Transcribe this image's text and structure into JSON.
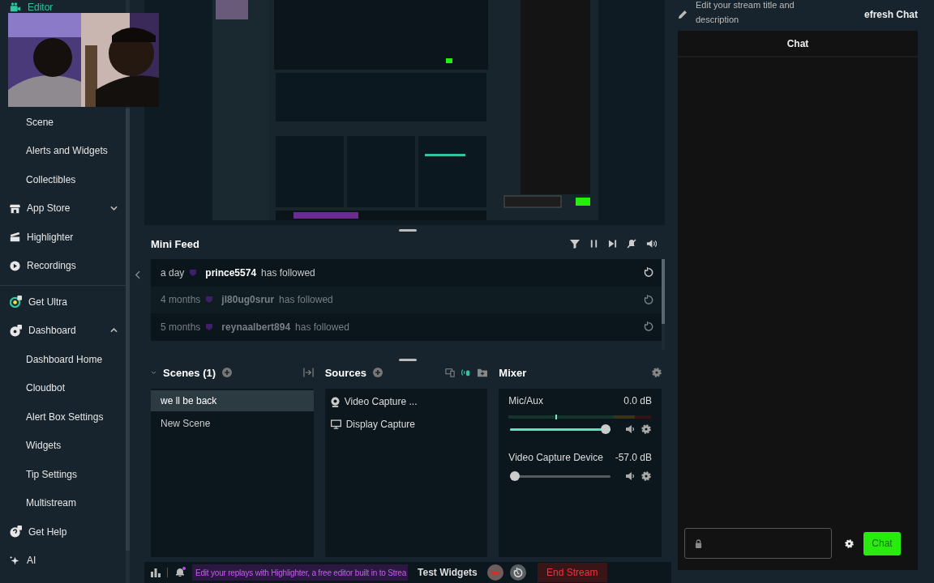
{
  "sidebar": {
    "items": [
      {
        "label": "Editor",
        "kind": "editor",
        "selected": true
      },
      {
        "label": "Scene",
        "kind": "sub",
        "selected": false
      },
      {
        "label": "Alerts and Widgets",
        "kind": "sub",
        "selected": false
      },
      {
        "label": "Collectibles",
        "kind": "sub",
        "selected": false
      },
      {
        "label": "App Store",
        "kind": "store",
        "selected": false,
        "expanded": false
      },
      {
        "label": "Highlighter",
        "kind": "highlighter",
        "selected": false
      },
      {
        "label": "Recordings",
        "kind": "recordings",
        "selected": false
      },
      {
        "kind": "divider"
      },
      {
        "label": "Get Ultra",
        "kind": "ultra",
        "selected": false
      },
      {
        "label": "Dashboard",
        "kind": "dashboard",
        "selected": false,
        "expanded": true
      },
      {
        "label": "Dashboard Home",
        "kind": "sub",
        "selected": false
      },
      {
        "label": "Cloudbot",
        "kind": "sub",
        "selected": false
      },
      {
        "label": "Alert Box Settings",
        "kind": "sub",
        "selected": false
      },
      {
        "label": "Widgets",
        "kind": "sub",
        "selected": false
      },
      {
        "label": "Tip Settings",
        "kind": "sub",
        "selected": false
      },
      {
        "label": "Multistream",
        "kind": "sub",
        "selected": false
      },
      {
        "label": "Get Help",
        "kind": "help",
        "selected": false
      },
      {
        "label": "AI",
        "kind": "ai",
        "selected": false
      }
    ]
  },
  "mini_feed": {
    "title": "Mini Feed",
    "rows": [
      {
        "time": "a day",
        "user": "prince5574",
        "action": "has followed",
        "recent": true
      },
      {
        "time": "4 months",
        "user": "jl80ug0srur",
        "action": "has followed",
        "recent": false
      },
      {
        "time": "5 months",
        "user": "reynaalbert894",
        "action": "has followed",
        "recent": false
      }
    ]
  },
  "scenes": {
    "title": "Scenes (1)",
    "items": [
      {
        "label": "we ll be back",
        "selected": true
      },
      {
        "label": "New Scene",
        "selected": false
      }
    ]
  },
  "sources": {
    "title": "Sources",
    "items": [
      {
        "label": "Video Capture ...",
        "kind": "webcam"
      },
      {
        "label": "Display Capture",
        "kind": "display"
      }
    ]
  },
  "mixer": {
    "title": "Mixer",
    "channels": [
      {
        "name": "Mic/Aux",
        "reading": "0.0 dB",
        "level": 1.0
      },
      {
        "name": "Video Capture Device",
        "reading": "-57.0 dB",
        "level": 0.0
      }
    ]
  },
  "footer": {
    "notice": "Edit your replays with Highlighter, a free editor built in to Strea",
    "test_widgets": "Test Widgets",
    "end_stream": "End Stream"
  },
  "right": {
    "edit_hint": "Edit your stream title and description",
    "refresh": "efresh Chat",
    "chat_title": "Chat",
    "send": "Chat"
  }
}
